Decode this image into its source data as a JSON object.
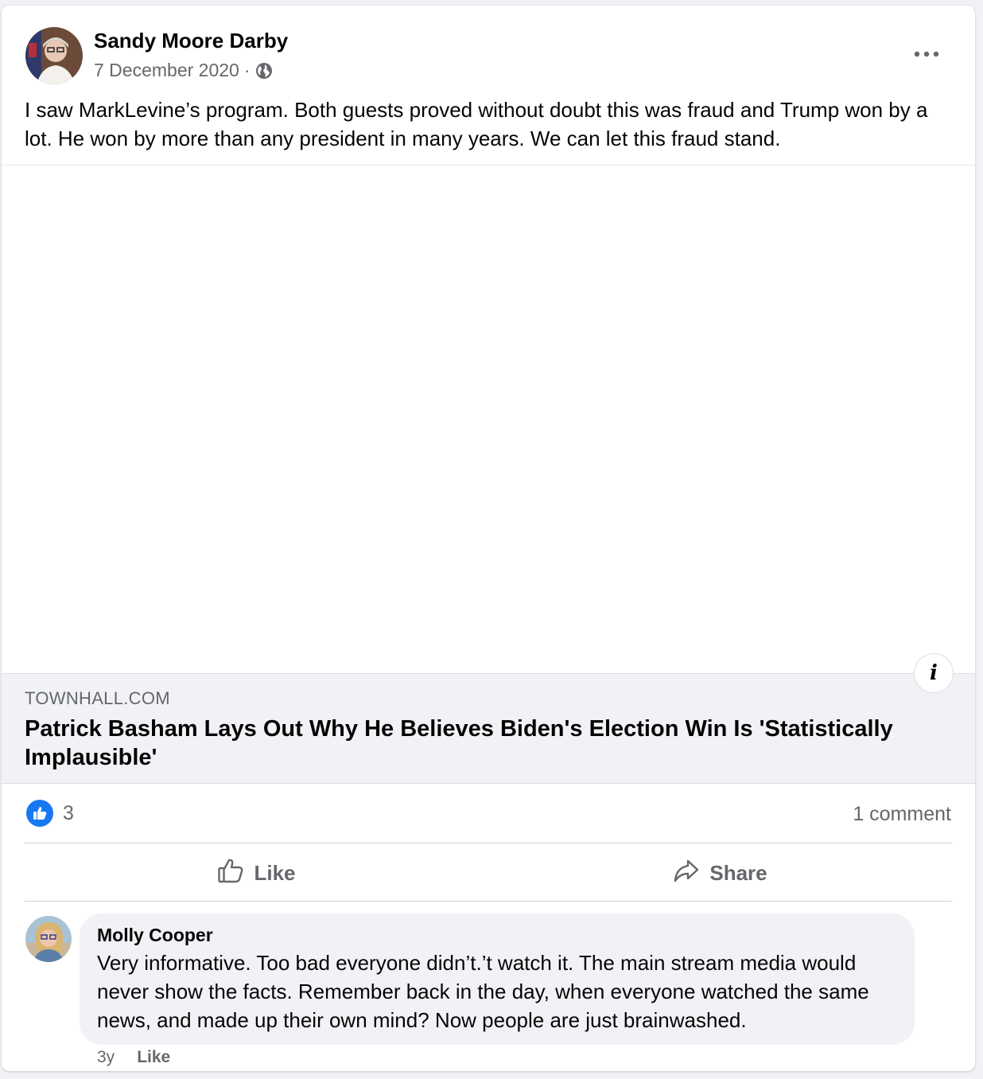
{
  "post": {
    "author": "Sandy Moore Darby",
    "date": "7 December 2020",
    "separator": "·",
    "privacy_icon": "globe-icon",
    "more_icon": "more-options-icon",
    "text": "I saw MarkLevine’s program.  Both guests proved without doubt this was fraud and Trump won by a lot.  He won by more than any president in many years.  We can let this fraud stand."
  },
  "link_preview": {
    "info_label": "i",
    "domain": "TOWNHALL.COM",
    "title": "Patrick Basham Lays Out Why He Believes Biden's Election Win Is 'Statistically Implausible'"
  },
  "stats": {
    "reaction_icon": "like-reaction-icon",
    "reaction_count": "3",
    "comment_count": "1 comment"
  },
  "actions": {
    "like_label": "Like",
    "share_label": "Share"
  },
  "comment": {
    "author": "Molly Cooper",
    "text": "Very informative. Too bad everyone didn’t.’t watch it. The main stream media would never show the facts. Remember back in the day, when everyone watched the same news, and made up their own mind? Now people are just brainwashed.",
    "age": "3y",
    "like_label": "Like"
  },
  "colors": {
    "brand_blue": "#1877f2",
    "secondary_text": "#65676b",
    "background": "#f0f2f5"
  }
}
